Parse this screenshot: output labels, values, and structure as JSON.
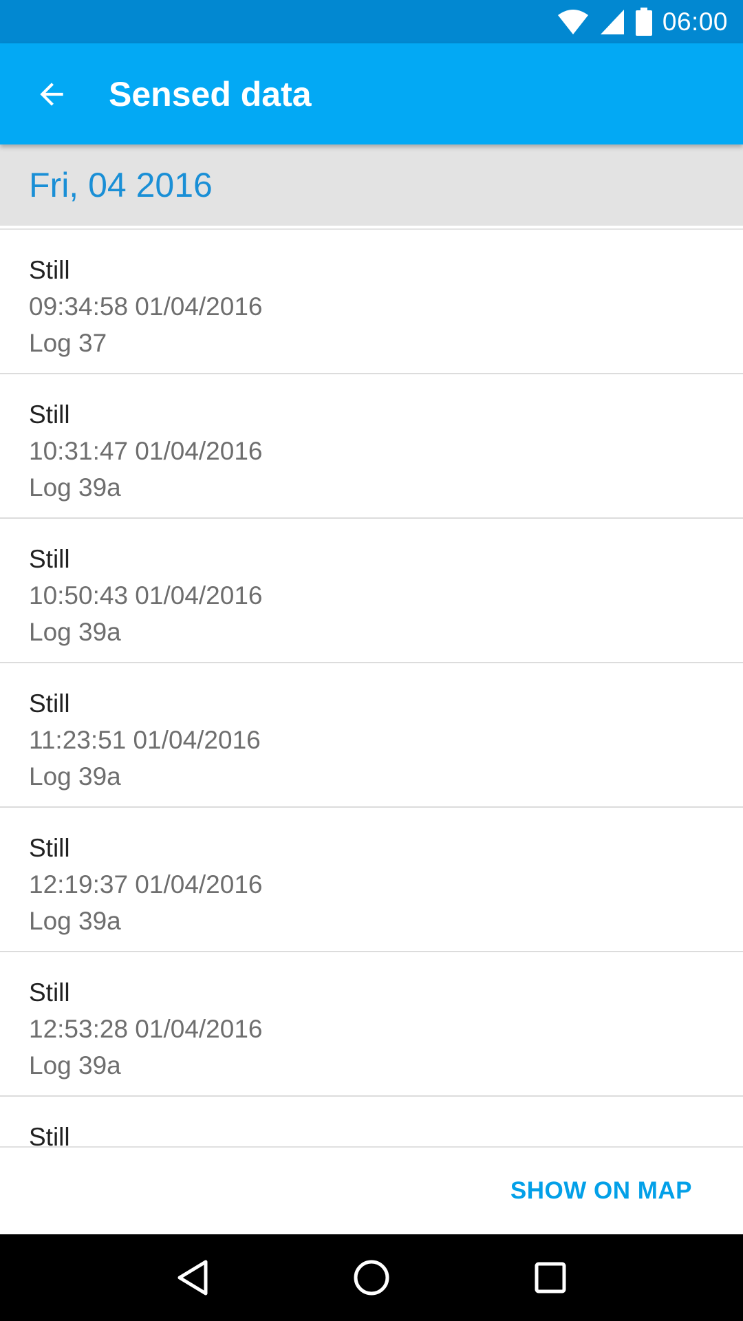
{
  "status_bar": {
    "time": "06:00",
    "icons": [
      "wifi-icon",
      "signal-icon",
      "battery-icon"
    ]
  },
  "app_bar": {
    "title": "Sensed data",
    "back_icon": "arrow-back-icon"
  },
  "date_header": {
    "label": "Fri, 04 2016"
  },
  "list": {
    "items": [
      {
        "activity": "Still",
        "timestamp": "09:34:58 01/04/2016",
        "log": "Log 37"
      },
      {
        "activity": "Still",
        "timestamp": "10:31:47 01/04/2016",
        "log": "Log 39a"
      },
      {
        "activity": "Still",
        "timestamp": "10:50:43 01/04/2016",
        "log": "Log 39a"
      },
      {
        "activity": "Still",
        "timestamp": "11:23:51 01/04/2016",
        "log": "Log 39a"
      },
      {
        "activity": "Still",
        "timestamp": "12:19:37 01/04/2016",
        "log": "Log 39a"
      },
      {
        "activity": "Still",
        "timestamp": "12:53:28 01/04/2016",
        "log": "Log 39a"
      },
      {
        "activity": "Still"
      }
    ]
  },
  "footer": {
    "show_on_map_label": "SHOW ON MAP"
  },
  "nav_bar": {
    "icons": [
      "back-triangle-icon",
      "home-circle-icon",
      "recents-square-icon"
    ]
  },
  "colors": {
    "status_bar": "#0288d1",
    "app_bar": "#03a9f4",
    "date_header_bg": "#e3e3e3",
    "date_header_text": "#1a8fd6",
    "accent": "#03a0e8"
  }
}
